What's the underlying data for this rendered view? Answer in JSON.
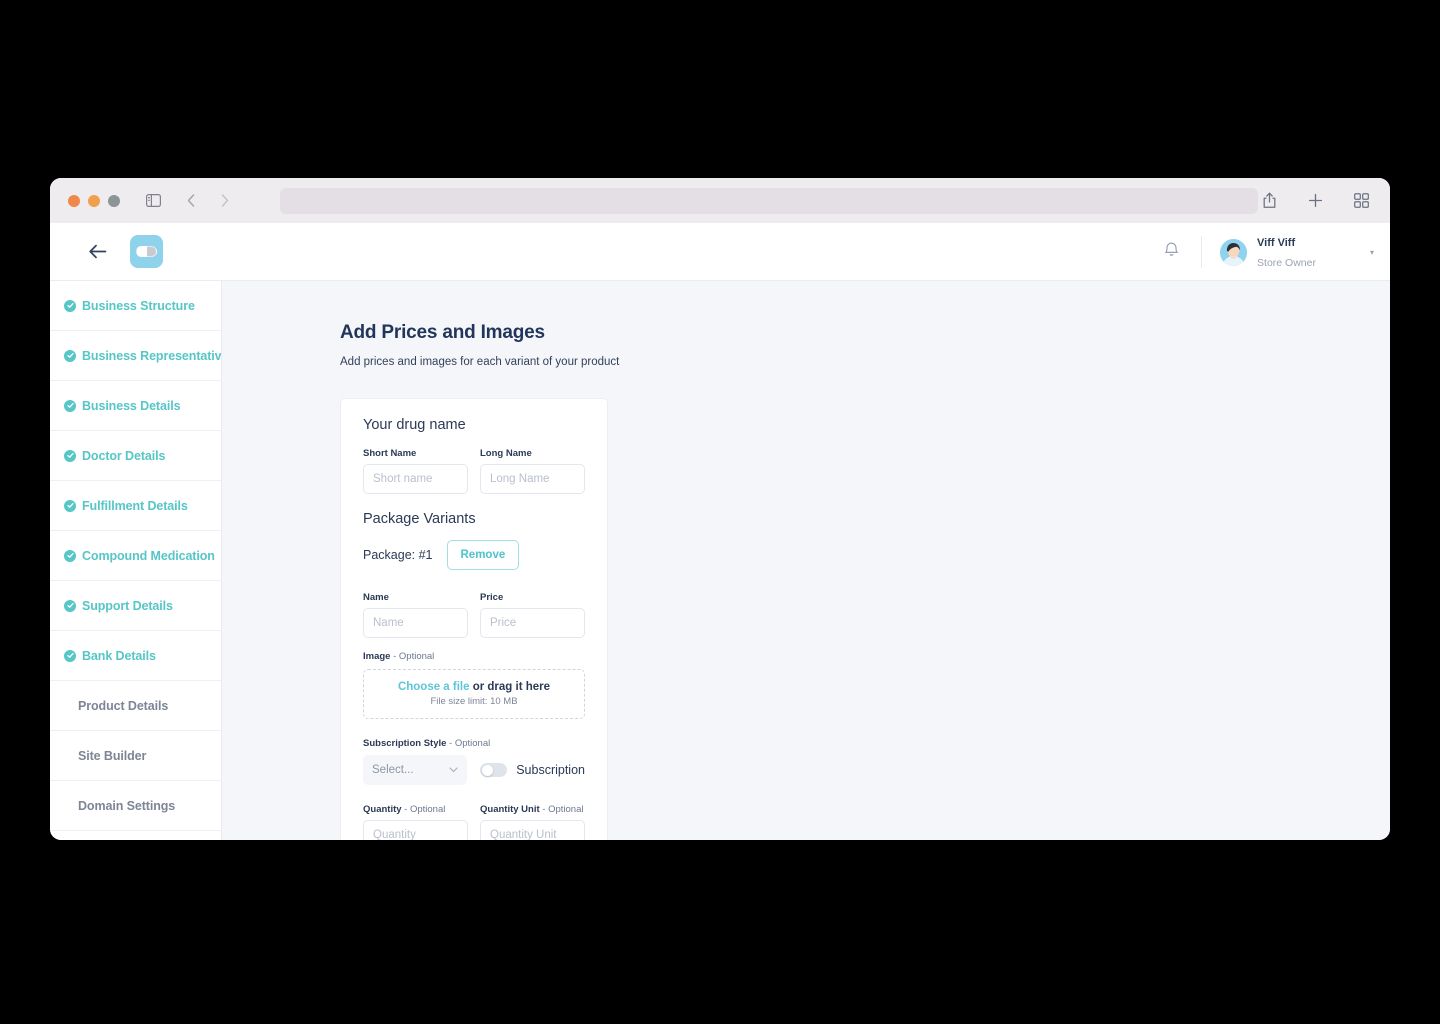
{
  "browser": {
    "url": "",
    "url_placeholder": "",
    "icons": {
      "sidebar": "sidebar-toggle-icon",
      "back": "back-chevron-icon",
      "forward": "forward-chevron-icon",
      "share": "share-icon",
      "new_tab": "plus-icon",
      "tabs": "tab-overview-icon"
    }
  },
  "appbar": {
    "back_label": "←",
    "logo_name": "pharmacy-logo",
    "notifications_icon": "bell-icon",
    "user": {
      "name": "Viff Viff",
      "role": "Store Owner",
      "caret": "▾"
    }
  },
  "sidebar": {
    "items": [
      {
        "label": "Business Structure",
        "complete": true
      },
      {
        "label": "Business Representative",
        "complete": true
      },
      {
        "label": "Business Details",
        "complete": true
      },
      {
        "label": "Doctor Details",
        "complete": true
      },
      {
        "label": "Fulfillment Details",
        "complete": true
      },
      {
        "label": "Compound Medication",
        "complete": true
      },
      {
        "label": "Support Details",
        "complete": true
      },
      {
        "label": "Bank Details",
        "complete": true
      },
      {
        "label": "Product Details",
        "complete": false
      },
      {
        "label": "Site Builder",
        "complete": false
      },
      {
        "label": "Domain Settings",
        "complete": false
      }
    ]
  },
  "main": {
    "title": "Add Prices and Images",
    "subtitle": "Add prices and images for each variant of your product",
    "card": {
      "title": "Your drug name",
      "short_name": {
        "label": "Short Name",
        "value": "",
        "placeholder": "Short name"
      },
      "long_name": {
        "label": "Long Name",
        "value": "",
        "placeholder": "Long Name"
      },
      "package_variants_title": "Package Variants",
      "package_label": "Package: #1",
      "remove_label": "Remove",
      "name": {
        "label": "Name",
        "value": "",
        "placeholder": "Name"
      },
      "price": {
        "label": "Price",
        "value": "",
        "placeholder": "Price"
      },
      "image": {
        "label": "Image",
        "optional": " - Optional",
        "link_text": "Choose a file",
        "rest_text": " or drag it here",
        "size_limit": "File size limit: 10 MB"
      },
      "subscription_style": {
        "label": "Subscription Style",
        "optional": " - Optional",
        "selected": "Select...",
        "toggle_label": "Subscription",
        "toggle_on": false
      },
      "quantity": {
        "label": "Quantity",
        "optional": " - Optional",
        "value": "",
        "placeholder": "Quantity"
      },
      "quantity_unit": {
        "label": "Quantity Unit",
        "optional": " - Optional",
        "value": "",
        "placeholder": "Quantity Unit"
      }
    }
  },
  "colors": {
    "teal": "#56c6c6",
    "navy": "#22365c",
    "bg": "#f5f6f9",
    "link": "#5cc6d8"
  }
}
